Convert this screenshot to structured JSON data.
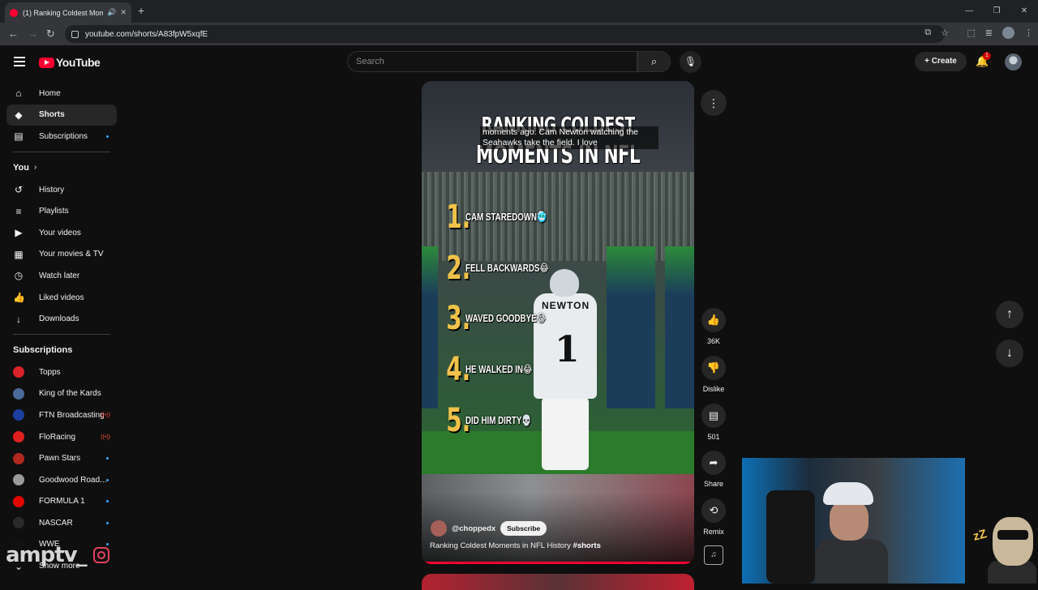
{
  "browser": {
    "tab_title": "(1) Ranking Coldest Mome",
    "url": "youtube.com/shorts/A83fpW5xqfE"
  },
  "header": {
    "logo_text": "YouTube",
    "search_placeholder": "Search",
    "create_label": "Create",
    "notification_count": "1"
  },
  "sidebar": {
    "main": [
      {
        "label": "Home",
        "icon": "home-icon",
        "glyph": "⌂"
      },
      {
        "label": "Shorts",
        "icon": "shorts-icon",
        "glyph": "◆"
      },
      {
        "label": "Subscriptions",
        "icon": "subscriptions-icon",
        "glyph": "▤"
      }
    ],
    "you_label": "You",
    "you": [
      {
        "label": "History",
        "icon": "history-icon",
        "glyph": "↺"
      },
      {
        "label": "Playlists",
        "icon": "playlists-icon",
        "glyph": "≡"
      },
      {
        "label": "Your videos",
        "icon": "your-videos-icon",
        "glyph": "▶"
      },
      {
        "label": "Your movies & TV",
        "icon": "movies-icon",
        "glyph": "▦"
      },
      {
        "label": "Watch later",
        "icon": "watch-later-icon",
        "glyph": "◷"
      },
      {
        "label": "Liked videos",
        "icon": "liked-videos-icon",
        "glyph": "👍"
      },
      {
        "label": "Downloads",
        "icon": "downloads-icon",
        "glyph": "↓"
      }
    ],
    "subs_label": "Subscriptions",
    "subs": [
      {
        "label": "Topps",
        "color": "#d8232a",
        "indicator": "none"
      },
      {
        "label": "King of the Kards",
        "color": "#4a6a9a",
        "indicator": "none"
      },
      {
        "label": "FTN Broadcasting",
        "color": "#1b3fa0",
        "indicator": "live"
      },
      {
        "label": "FloRacing",
        "color": "#e02020",
        "indicator": "live"
      },
      {
        "label": "Pawn Stars",
        "color": "#b0281e",
        "indicator": "dot"
      },
      {
        "label": "Goodwood Road...",
        "color": "#9a9a9a",
        "indicator": "dot"
      },
      {
        "label": "FORMULA 1",
        "color": "#e10600",
        "indicator": "dot"
      },
      {
        "label": "NASCAR",
        "color": "#2a2a2a",
        "indicator": "dot"
      },
      {
        "label": "WWE",
        "color": "#111111",
        "indicator": "dot"
      }
    ],
    "show_more": "Show more"
  },
  "short": {
    "overlay_title_line1": "RANKING COLDEST",
    "overlay_title_line2": "MOMENTS IN NFL HISTORY",
    "caption": "moments ago. Cam Newton watching the Seahawks take the field. I love",
    "rankings": [
      {
        "num": "1.",
        "label": "CAM STAREDOWN🥶"
      },
      {
        "num": "2.",
        "label": "FELL BACKWARDS😂"
      },
      {
        "num": "3.",
        "label": "WAVED GOODBYE😂"
      },
      {
        "num": "4.",
        "label": "HE WALKED IN😂"
      },
      {
        "num": "5.",
        "label": "DID HIM DIRTY💀"
      }
    ],
    "jersey_name": "NEWTON",
    "jersey_number": "1",
    "channel_handle": "@choppedx",
    "subscribe_label": "Subscribe",
    "video_title": "Ranking Coldest Moments in NFL History",
    "hashtag": "#shorts"
  },
  "actions": {
    "likes": "36K",
    "dislike_label": "Dislike",
    "comments": "501",
    "share_label": "Share",
    "remix_label": "Remix"
  },
  "watermark": {
    "text": "amptv_"
  }
}
